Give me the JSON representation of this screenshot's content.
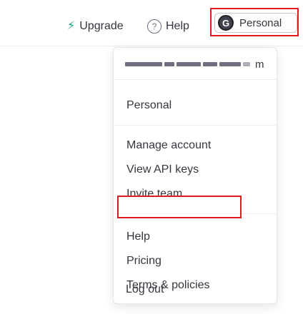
{
  "header": {
    "upgrade_label": "Upgrade",
    "help_label": "Help",
    "account": {
      "avatar_initial": "G",
      "label": "Personal"
    }
  },
  "dropdown": {
    "email_tail": "m",
    "section_title": "Personal",
    "items_account": [
      "Manage account",
      "View API keys",
      "Invite team"
    ],
    "items_info": [
      "Help",
      "Pricing",
      "Terms & policies",
      "Log out"
    ]
  },
  "colors": {
    "accent": "#10a37f",
    "highlight": "#e0191f",
    "text": "#353740"
  }
}
